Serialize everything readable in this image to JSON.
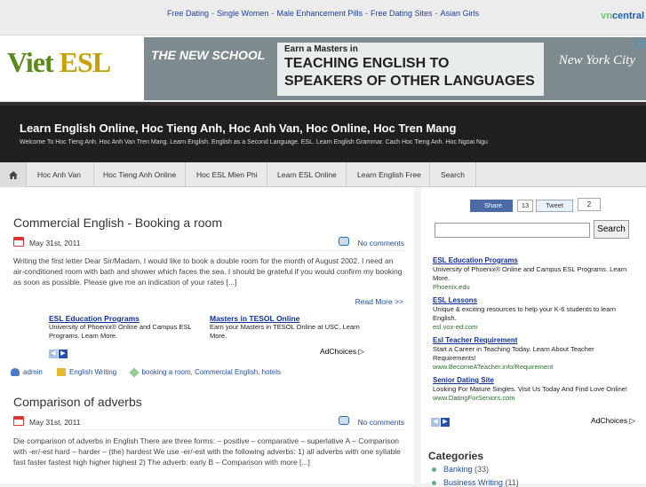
{
  "topbar": {
    "links": [
      "Free Dating",
      "Single Women",
      "Male Enhancement Pills",
      "Free Dating Sites",
      "Asian Girls"
    ],
    "logo_vn": "vn",
    "logo_central": "central"
  },
  "header": {
    "logo_viet": "Viet",
    "logo_esl": "ESL",
    "banner": {
      "school": "THE NEW SCHOOL",
      "line1": "Earn a Masters in",
      "line2": "TEACHING ENGLISH TO",
      "line3": "SPEAKERS OF OTHER LANGUAGES",
      "city": "New York City",
      "ad_info": "i"
    }
  },
  "site": {
    "title": "Learn English Online, Hoc Tieng Anh, Hoc Anh Van, Hoc Online, Hoc Tren Mang",
    "description": "Welcome To Hoc Tieng Anh. Hoc Anh Van Tren Mang. Learn English. English as a Second Language. ESL. Learn English Grammar. Cach Hoc Tieng Anh. Hoc Ngoai Ngu"
  },
  "nav": {
    "home_icon": "home-icon",
    "items": [
      "Hoc Anh Van",
      "Hoc Tieng Anh Online",
      "Hoc ESL Mien Phi",
      "Learn ESL Online",
      "Learn English Free",
      "Search"
    ]
  },
  "posts": [
    {
      "title": "Commercial English - Booking a room",
      "date": "May 31st, 2011",
      "comments": "No comments",
      "excerpt": "Writing the first letter Dear Sir/Madam, I would like to book a double room for the month of August 2002. I need an air-conditioned room with bath and shower which faces the sea. I should be grateful if you would confirm my booking as soon as possible. Please give me an indication of your rates [...]",
      "read_more": "Read More >>",
      "author": "admin",
      "category": "English Writing",
      "tags": "booking a room, Commercial English, hotels"
    },
    {
      "title": "Comparison of adverbs",
      "date": "May 31st, 2011",
      "comments": "No comments",
      "excerpt": "Die comparison of adverbs in English There are three forms: – positive – comparative – superlative A – Comparison with -er/-est hard – harder – (the) hardest We use -er/-est with the following adverbs: 1) all adverbs with one syllable fast faster fastest high higher highest 2) The adverb: early B – Comparison with more [...]"
    }
  ],
  "inline_ads": {
    "ad1": {
      "title": "ESL Education Programs",
      "text": "University of Phoenix® Online and Campus ESL Programs. Learn More."
    },
    "ad2": {
      "title": "Masters in TESOL Online",
      "text": "Earn your Masters in TESOL Online at USC. Learn More."
    },
    "adchoices": "AdChoices ▷"
  },
  "share": {
    "fb_label": "Share",
    "fb_count": "13",
    "tw_label": "Tweet",
    "tw_count": "2"
  },
  "search": {
    "button": "Search",
    "value": ""
  },
  "side_ads": [
    {
      "title": "ESL Education Programs",
      "text": "University of Phoenix® Online and Campus ESL Programs. Learn More.",
      "url": "Phoenix.edu"
    },
    {
      "title": "ESL Lessons",
      "text": "Unique & exciting resources to help your K-6 students to learn English.",
      "url": "esl.vox-ed.com"
    },
    {
      "title": "Esl Teacher Requirement",
      "text": "Start a Career in Teaching Today. Learn About Teacher Requirements!",
      "url": "www.BecomeATeacher.info/Requirement"
    },
    {
      "title": "Senior Dating Site",
      "text": "Looking For Mature Singles. Visit Us Today And Find Love Online!",
      "url": "www.DatingForSeniors.com"
    }
  ],
  "side_adchoices": "AdChoices ▷",
  "categories": {
    "heading": "Categories",
    "items": [
      {
        "name": "Banking",
        "count": "(33)"
      },
      {
        "name": "Business Writing",
        "count": "(11)"
      }
    ]
  }
}
